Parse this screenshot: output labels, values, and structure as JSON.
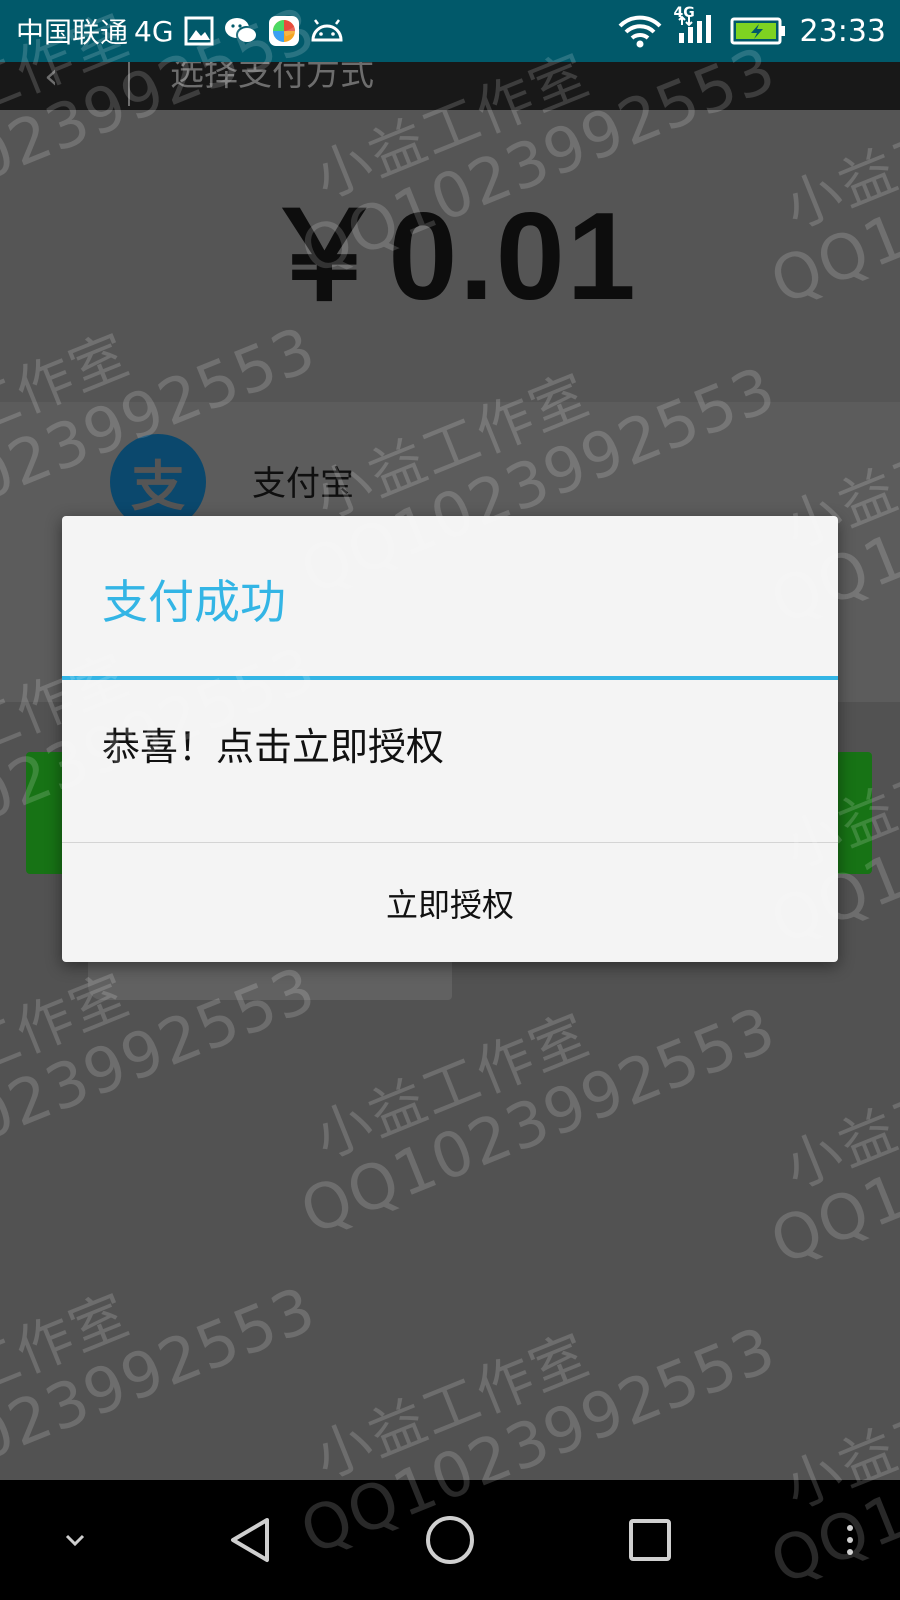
{
  "status_bar": {
    "carrier": "中国联通",
    "network": "4G",
    "signal_network": "4G",
    "time": "23:33",
    "icons": [
      "gallery-icon",
      "wechat-icon",
      "app-store-icon",
      "android-debug-icon",
      "wifi-icon",
      "cell-signal-icon",
      "battery-charging-icon"
    ],
    "accent": "#01596a"
  },
  "page": {
    "appbar_title": "选择支付方式",
    "amount": "￥0.01",
    "payment_method": "支付宝"
  },
  "watermark": {
    "line1": "小益工作室",
    "line2": "QQ1023992553"
  },
  "dialog": {
    "title": "支付成功",
    "message": "恭喜！点击立即授权",
    "button_label": "立即授权",
    "accent": "#33b5e5"
  },
  "nav_bar": {
    "items": [
      "chevron-down-icon",
      "back-icon",
      "home-icon",
      "recents-icon",
      "more-vert-icon"
    ]
  }
}
